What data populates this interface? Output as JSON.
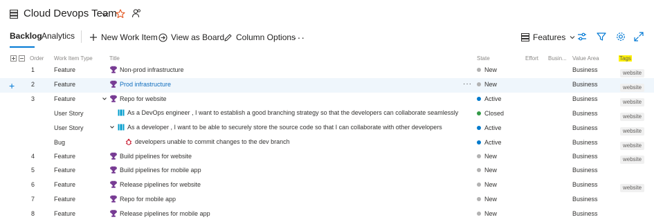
{
  "header": {
    "team_title": "Cloud Devops Team"
  },
  "tabs": {
    "backlog": "Backlog",
    "analytics": "Analytics"
  },
  "toolbar": {
    "new_work_item": "New Work Item",
    "view_as_board": "View as Board",
    "column_options": "Column Options",
    "more": "···",
    "features": "Features"
  },
  "columns": {
    "order": "Order",
    "work_item_type": "Work Item Type",
    "title": "Title",
    "state": "State",
    "effort": "Effort",
    "business": "Busin...",
    "value_area": "Value Area",
    "tags": "Tags"
  },
  "colors": {
    "accent": "#0078d4",
    "feature_icon": "#773b93",
    "story_icon": "#009ccc",
    "bug_icon": "#cc293d",
    "state_new": "#b2b2b2",
    "state_active": "#007acc",
    "state_closed": "#339947",
    "selected_row": "#eff6fc",
    "tags_highlight": "#fff100"
  },
  "rows": [
    {
      "order": "1",
      "type": "Feature",
      "title": "Non-prod infrastructure",
      "state": "New",
      "value_area": "Business",
      "tag": "website"
    },
    {
      "order": "2",
      "type": "Feature",
      "title": "Prod infrastructure",
      "state": "New",
      "value_area": "Business",
      "tag": "website"
    },
    {
      "order": "3",
      "type": "Feature",
      "title": "Repo for website",
      "state": "Active",
      "value_area": "Business",
      "tag": "website"
    },
    {
      "order": "",
      "type": "User Story",
      "title": "As a DevOps engineer , I want to establish a good branching strategy so that the developers can collaborate seamlessly",
      "state": "Closed",
      "value_area": "Business",
      "tag": "website"
    },
    {
      "order": "",
      "type": "User Story",
      "title": "As a developer , I want to be able to securely store the source code so that I can collaborate with other developers",
      "state": "Active",
      "value_area": "Business",
      "tag": "website"
    },
    {
      "order": "",
      "type": "Bug",
      "title": "developers unable to commit changes to the dev branch",
      "state": "Active",
      "value_area": "Business",
      "tag": "website"
    },
    {
      "order": "4",
      "type": "Feature",
      "title": "Build pipelines for website",
      "state": "New",
      "value_area": "Business",
      "tag": "website"
    },
    {
      "order": "5",
      "type": "Feature",
      "title": "Build pipelines for mobile app",
      "state": "New",
      "value_area": "Business",
      "tag": ""
    },
    {
      "order": "6",
      "type": "Feature",
      "title": "Release pipelines for website",
      "state": "New",
      "value_area": "Business",
      "tag": "website"
    },
    {
      "order": "7",
      "type": "Feature",
      "title": "Repo for mobile app",
      "state": "New",
      "value_area": "Business",
      "tag": ""
    },
    {
      "order": "8",
      "type": "Feature",
      "title": "Release pipelines for mobile app",
      "state": "New",
      "value_area": "Business",
      "tag": ""
    }
  ]
}
